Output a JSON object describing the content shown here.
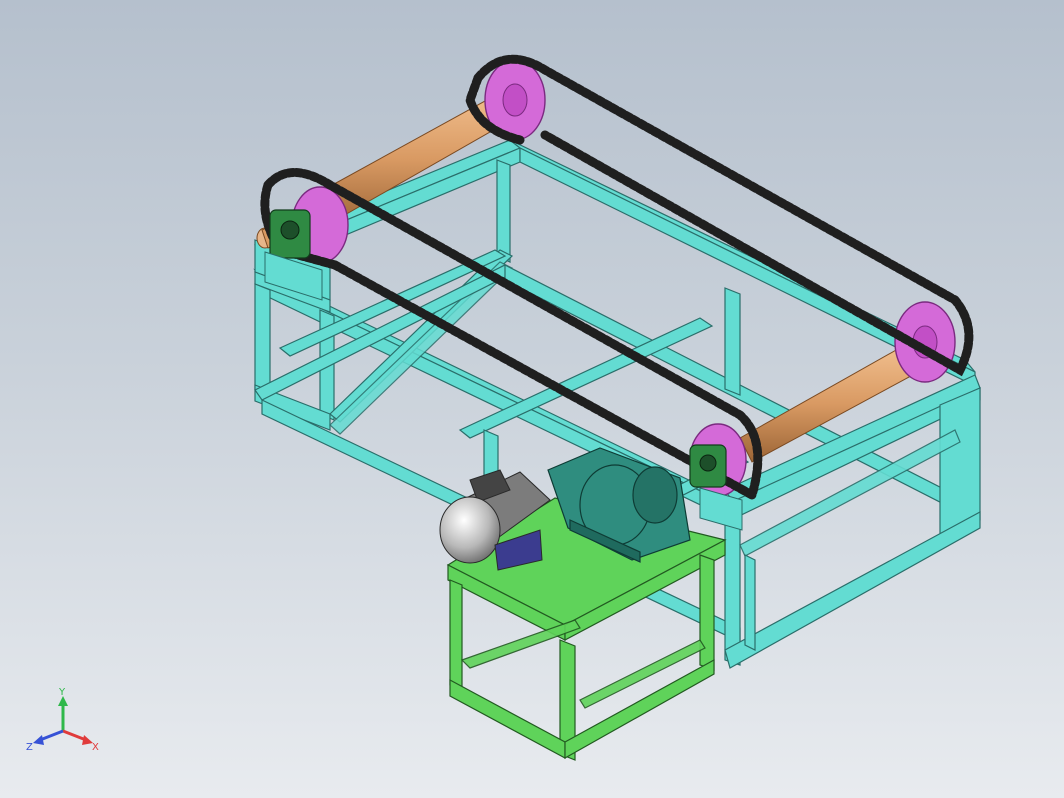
{
  "view": {
    "background_top": "#b5c0cd",
    "background_bottom": "#e8ebef"
  },
  "colors": {
    "main_frame": "#63dcd2",
    "motor_stand": "#5fd35a",
    "roller": "#d99a63",
    "sprocket": "#d46ad8",
    "chain": "#1f1f1f",
    "bearing": "#2f8a43",
    "gearbox": "#2f8d7f",
    "motor": "#9c9c9c"
  },
  "components": [
    {
      "name": "main-frame",
      "icon": "frame-icon"
    },
    {
      "name": "motor-stand",
      "icon": "table-icon"
    },
    {
      "name": "roller-shaft",
      "icon": "shaft-icon"
    },
    {
      "name": "sprocket",
      "icon": "gear-icon"
    },
    {
      "name": "roller-chain",
      "icon": "chain-icon"
    },
    {
      "name": "pillow-block-bearing",
      "icon": "bearing-icon"
    },
    {
      "name": "gear-reducer",
      "icon": "gearbox-icon"
    },
    {
      "name": "electric-motor",
      "icon": "motor-icon"
    }
  ],
  "triad": {
    "y_label": "Y",
    "x_label": "X",
    "z_label": "Z",
    "y_color": "#2fb84a",
    "x_color": "#e03b3b",
    "z_color": "#3652d6"
  }
}
